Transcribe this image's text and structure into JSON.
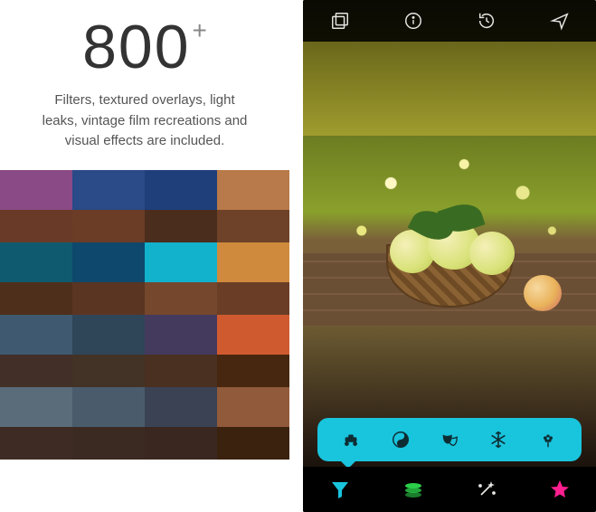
{
  "left": {
    "big_number": "800",
    "plus": "+",
    "subtitle_line1": "Filters, textured overlays, light",
    "subtitle_line2": "leaks, vintage film recreations and",
    "subtitle_line3": "visual effects are included.",
    "thumbs": [
      {
        "sky": "#8a4a86",
        "land": "#6a3a28"
      },
      {
        "sky": "#2a4a88",
        "land": "#6b3c26"
      },
      {
        "sky": "#1f3f7a",
        "land": "#4a2d1d"
      },
      {
        "sky": "#b87a4a",
        "land": "#6e4228"
      },
      {
        "sky": "#105a70",
        "land": "#4e2f1c"
      },
      {
        "sky": "#0e486c",
        "land": "#5a3522"
      },
      {
        "sky": "#12b2cc",
        "land": "#75472c"
      },
      {
        "sky": "#d08a3d",
        "land": "#6a3e26"
      },
      {
        "sky": "#3f5a70",
        "land": "#423028"
      },
      {
        "sky": "#2f4558",
        "land": "#433226"
      },
      {
        "sky": "#443a5e",
        "land": "#4a3020"
      },
      {
        "sky": "#d05a30",
        "land": "#47270f"
      },
      {
        "sky": "#5a6c7a",
        "land": "#3e2c24"
      },
      {
        "sky": "#4a5c6c",
        "land": "#3b2a22"
      },
      {
        "sky": "#3a4254",
        "land": "#3a2820"
      },
      {
        "sky": "#915a3a",
        "land": "#3a220f"
      }
    ]
  },
  "right": {
    "top_icons": [
      "photo-stack-icon",
      "info-icon",
      "history-icon",
      "share-icon"
    ],
    "category_icons": [
      "vehicle-icon",
      "yinyang-icon",
      "theater-masks-icon",
      "snowflake-icon",
      "flower-icon"
    ],
    "nav_icons": [
      "funnel-icon",
      "layers-icon",
      "wand-icon",
      "star-icon"
    ]
  }
}
